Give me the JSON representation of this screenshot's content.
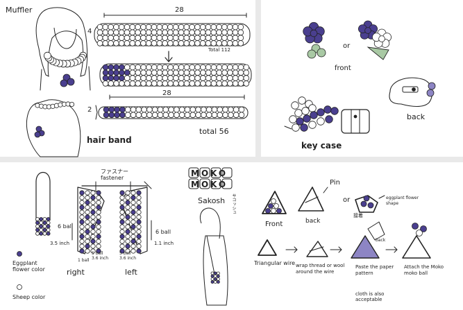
{
  "colors": {
    "eggplant": "#4a3f8f",
    "eggplant_light": "#8d85c4",
    "sheep": "#ffffff",
    "stroke": "#222222",
    "sage": "#a9c9a4"
  },
  "muffler": {
    "title": "Muffler",
    "row1_count": "4",
    "row1_top": "28",
    "row1_total": "Total 112",
    "row2_count": "2",
    "row2_top": "28",
    "row2_total": "total 56",
    "hairband_label": "hair band"
  },
  "key_case": {
    "front_label": "front",
    "or_label": "or",
    "back_label": "back",
    "key_case_label": "key case"
  },
  "bag": {
    "fastener_label": "ファスナー\nfastener",
    "left_6ball": "6 ball",
    "left_inch": "3.5 inch",
    "right_6ball": "6 ball",
    "right_inch": "1.1 inch",
    "bottom_right1": "1 ball",
    "bottom_right2": "5 ball\n3.6 inch",
    "bottom_left": "5 ball\n3.6 inch",
    "right_label": "right",
    "left_label": "left",
    "legend_eggplant": "Eggplant flower color",
    "legend_sheep": "Sheep color"
  },
  "sakosh": {
    "moko1": "MOKO",
    "moko2": "MOKO",
    "sakosh_label": "Sakosh",
    "jp_label": "サコッシュ"
  },
  "charm": {
    "pin_label": "Pin",
    "or_label": "or",
    "eggplant_shape": "eggplant flower shape",
    "front_label": "Front",
    "back_label": "back",
    "glue_label": "接着",
    "glue_back": "back",
    "step1": "Triangular wire",
    "step2": "wrap thread or wool around the wire",
    "step3": "Paste the paper pattern",
    "step3_note": "cloth is also acceptable",
    "step4": "Attach the Moko moko ball"
  }
}
